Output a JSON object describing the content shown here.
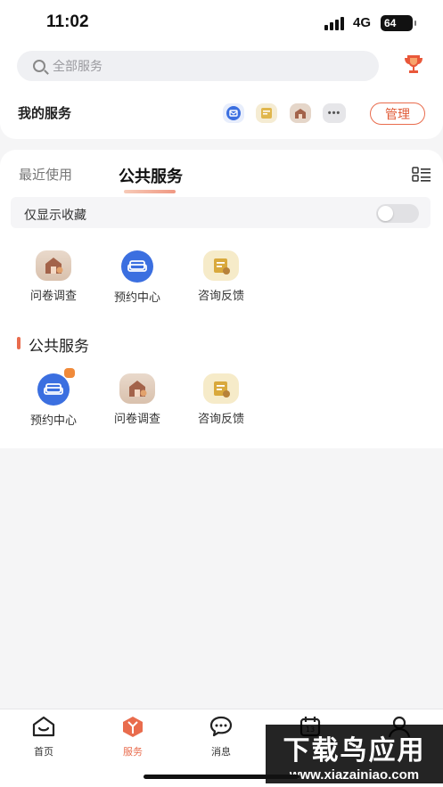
{
  "status_bar": {
    "time": "11:02",
    "network": "4G",
    "battery": "64"
  },
  "search": {
    "placeholder": "全部服务"
  },
  "my_services": {
    "title": "我的服务",
    "icons": [
      "mail-icon",
      "form-icon",
      "house-icon",
      "more-icon"
    ],
    "more_label": "•••",
    "manage_label": "管理"
  },
  "tabs": {
    "recent": "最近使用",
    "public": "公共服务"
  },
  "favorites_only": {
    "label": "仅显示收藏",
    "enabled": false
  },
  "recent_services": [
    {
      "label": "问卷调查",
      "icon": "survey-house-icon"
    },
    {
      "label": "预约中心",
      "icon": "sofa-icon"
    },
    {
      "label": "咨询反馈",
      "icon": "feedback-card-icon"
    }
  ],
  "public_section": {
    "title": "公共服务",
    "items": [
      {
        "label": "预约中心",
        "icon": "sofa-icon",
        "badge": true
      },
      {
        "label": "问卷调查",
        "icon": "survey-house-icon"
      },
      {
        "label": "咨询反馈",
        "icon": "feedback-card-icon"
      }
    ]
  },
  "tabbar": {
    "items": [
      {
        "label": "首页",
        "icon": "home-icon",
        "active": false
      },
      {
        "label": "服务",
        "icon": "service-box-icon",
        "active": true
      },
      {
        "label": "消息",
        "icon": "chat-icon",
        "active": false
      },
      {
        "label": "",
        "icon": "calendar-icon",
        "active": false
      },
      {
        "label": "",
        "icon": "profile-icon",
        "active": false
      }
    ]
  },
  "watermark": {
    "title": "下载鸟应用",
    "url": "www.xiazainiao.com"
  },
  "colors": {
    "accent": "#e96c4d",
    "blue": "#3b6fe0",
    "background": "#f5f5f6"
  }
}
